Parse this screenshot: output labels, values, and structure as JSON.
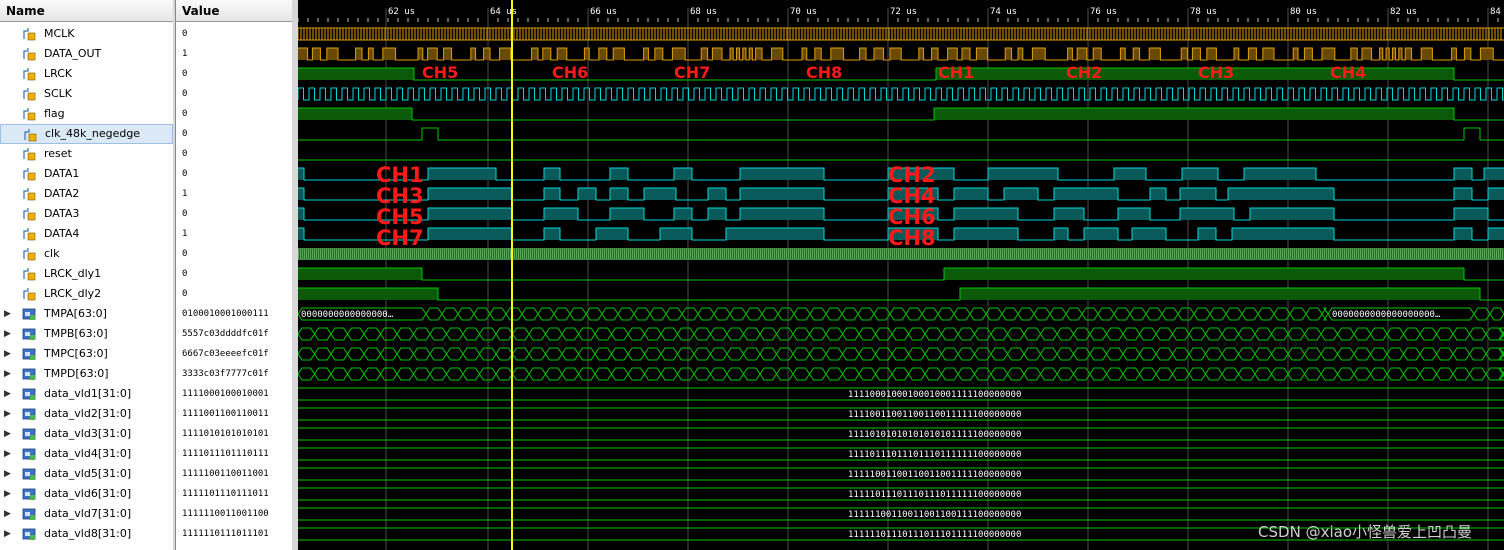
{
  "headers": {
    "name": "Name",
    "value": "Value"
  },
  "timeline": {
    "ticks": [
      "62 us",
      "64 us",
      "66 us",
      "68 us",
      "70 us",
      "72 us",
      "74 us",
      "76 us",
      "78 us",
      "80 us",
      "82 us",
      "84 us"
    ]
  },
  "signals": [
    {
      "name": "MCLK",
      "value": "0",
      "icon": "logic-icon"
    },
    {
      "name": "DATA_OUT",
      "value": "1",
      "icon": "logic-icon"
    },
    {
      "name": "LRCK",
      "value": "0",
      "icon": "logic-icon"
    },
    {
      "name": "SCLK",
      "value": "0",
      "icon": "logic-icon"
    },
    {
      "name": "flag",
      "value": "0",
      "icon": "logic-icon"
    },
    {
      "name": "clk_48k_negedge",
      "value": "0",
      "icon": "logic-icon"
    },
    {
      "name": "reset",
      "value": "0",
      "icon": "logic-icon"
    },
    {
      "name": "DATA1",
      "value": "0",
      "icon": "logic-icon"
    },
    {
      "name": "DATA2",
      "value": "1",
      "icon": "logic-icon"
    },
    {
      "name": "DATA3",
      "value": "0",
      "icon": "logic-icon"
    },
    {
      "name": "DATA4",
      "value": "1",
      "icon": "logic-icon"
    },
    {
      "name": "clk",
      "value": "0",
      "icon": "logic-icon"
    },
    {
      "name": "LRCK_dly1",
      "value": "0",
      "icon": "logic-icon"
    },
    {
      "name": "LRCK_dly2",
      "value": "0",
      "icon": "logic-icon"
    },
    {
      "name": "TMPA[63:0]",
      "value": "0100010001000111",
      "icon": "bus-icon"
    },
    {
      "name": "TMPB[63:0]",
      "value": "5557c03ddddfc01f",
      "icon": "bus-icon"
    },
    {
      "name": "TMPC[63:0]",
      "value": "6667c03eeeefc01f",
      "icon": "bus-icon"
    },
    {
      "name": "TMPD[63:0]",
      "value": "3333c03f7777c01f",
      "icon": "bus-icon"
    },
    {
      "name": "data_vld1[31:0]",
      "value": "1111000100010001",
      "icon": "bus-icon"
    },
    {
      "name": "data_vld2[31:0]",
      "value": "1111001100110011",
      "icon": "bus-icon"
    },
    {
      "name": "data_vld3[31:0]",
      "value": "1111010101010101",
      "icon": "bus-icon"
    },
    {
      "name": "data_vld4[31:0]",
      "value": "1111011101110111",
      "icon": "bus-icon"
    },
    {
      "name": "data_vld5[31:0]",
      "value": "1111100110011001",
      "icon": "bus-icon"
    },
    {
      "name": "data_vld6[31:0]",
      "value": "1111101110111011",
      "icon": "bus-icon"
    },
    {
      "name": "data_vld7[31:0]",
      "value": "1111110011001100",
      "icon": "bus-icon"
    },
    {
      "name": "data_vld8[31:0]",
      "value": "1111110111011101",
      "icon": "bus-icon"
    }
  ],
  "bus_text": {
    "tmpa_left": "0000000000000000…",
    "tmpa_right": "0000000000000000000…",
    "vld": [
      "11110001000100010001111100000000",
      "11110011001100110011111100000000",
      "11110101010101010101111100000000",
      "11110111011101110111111100000000",
      "11111001100110011001111100000000",
      "11111011101110111011111100000000",
      "11111100110011001100111100000000",
      "11111101110111011101111100000000"
    ]
  },
  "lrck_labels": [
    "CH5",
    "CH6",
    "CH7",
    "CH8",
    "CH1",
    "CH2",
    "CH3",
    "CH4"
  ],
  "data_labels_left": [
    "CH1",
    "CH3",
    "CH5",
    "CH7"
  ],
  "data_labels_right": [
    "CH2",
    "CH4",
    "CH6",
    "CH8"
  ],
  "watermark": "CSDN @xiao小怪兽爱上凹凸曼",
  "colors": {
    "green": "#00c800",
    "cyan": "#00d8d8",
    "orange": "#e0a000",
    "cursor": "#ffff00",
    "red": "#ff1a1a"
  }
}
